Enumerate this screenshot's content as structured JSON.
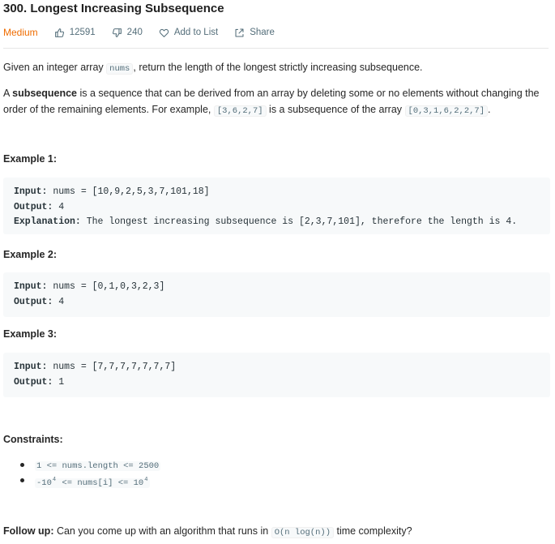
{
  "problem": {
    "title": "300. Longest Increasing Subsequence",
    "difficulty": "Medium",
    "likes": "12591",
    "dislikes": "240",
    "add_to_list": "Add to List",
    "share": "Share"
  },
  "description": {
    "p1_before": "Given an integer array ",
    "p1_code": "nums",
    "p1_after": ", return the length of the longest strictly increasing subsequence.",
    "p2_before_bold": "A ",
    "p2_bold": "subsequence",
    "p2_mid": " is a sequence that can be derived from an array by deleting some or no elements without changing the order of the remaining elements. For example, ",
    "p2_code1": "[3,6,2,7]",
    "p2_mid2": " is a subsequence of the array ",
    "p2_code2": "[0,3,1,6,2,2,7]",
    "p2_end": "."
  },
  "examples": [
    {
      "title": "Example 1:",
      "input_label": "Input:",
      "input": " nums = [10,9,2,5,3,7,101,18]",
      "output_label": "Output:",
      "output": " 4",
      "explanation_label": "Explanation:",
      "explanation": " The longest increasing subsequence is [2,3,7,101], therefore the length is 4."
    },
    {
      "title": "Example 2:",
      "input_label": "Input:",
      "input": " nums = [0,1,0,3,2,3]",
      "output_label": "Output:",
      "output": " 4"
    },
    {
      "title": "Example 3:",
      "input_label": "Input:",
      "input": " nums = [7,7,7,7,7,7,7]",
      "output_label": "Output:",
      "output": " 1"
    }
  ],
  "constraints": {
    "title": "Constraints:",
    "c1": "1 <= nums.length <= 2500",
    "c2_a": "-10",
    "c2_exp1": "4",
    "c2_b": " <= nums[i] <= 10",
    "c2_exp2": "4"
  },
  "follow_up": {
    "label": "Follow up:",
    "before": " Can you come up with an algorithm that runs in ",
    "code": "O(n log(n))",
    "after": " time complexity?"
  },
  "colors": {
    "difficulty_medium": "#ef6c00",
    "meta_gray": "#546e7a",
    "code_bg": "#f7f9fa"
  },
  "icons": [
    "thumbs-up-icon",
    "thumbs-down-icon",
    "heart-icon",
    "share-icon"
  ]
}
